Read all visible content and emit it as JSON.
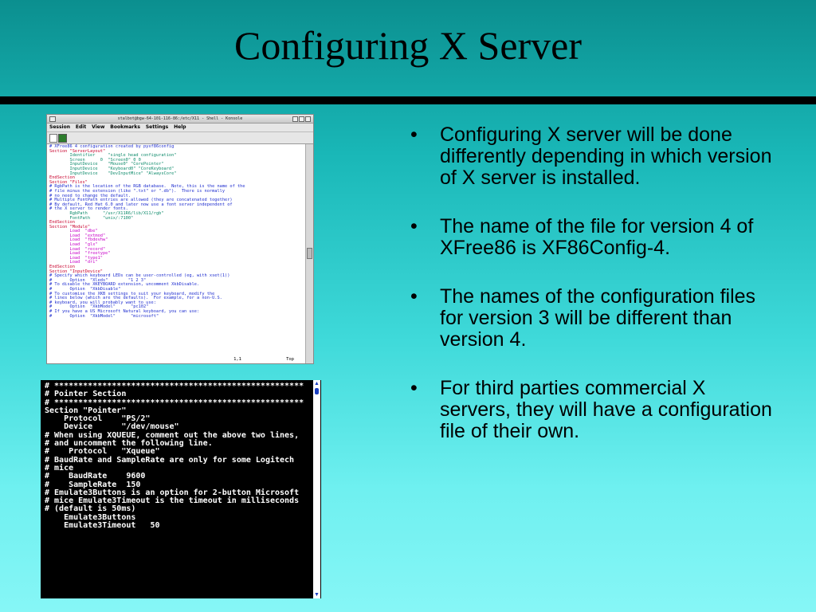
{
  "slide": {
    "title": "Configuring X Server",
    "bullets": [
      "Configuring X server will be done differently depending in which version of X server is installed.",
      "The name of the file for version 4 of XFree86 is XF86Config-4.",
      "The names of the configuration files for version 3 will be different than version 4.",
      "For third parties commercial X servers, they will have a configuration file of their own."
    ],
    "bullet_glyph": "•"
  },
  "konsole": {
    "title": "stalbot@bgw-64-101-116-86:/etc/X11 - Shell - Konsole",
    "menu": [
      "Session",
      "Edit",
      "View",
      "Bookmarks",
      "Settings",
      "Help"
    ],
    "lines": [
      {
        "t": "# XFree86 4 configuration created by pyxf86config",
        "c": "c-blue"
      },
      {
        "t": "",
        "c": ""
      },
      {
        "t": "Section \"ServerLayout\"",
        "c": "c-red"
      },
      {
        "t": "        Identifier     \"single head configuration\"",
        "c": "c-grn"
      },
      {
        "t": "        Screen      0  \"Screen0\" 0 0",
        "c": "c-grn"
      },
      {
        "t": "        InputDevice    \"Mouse0\" \"CorePointer\"",
        "c": "c-grn"
      },
      {
        "t": "        InputDevice    \"Keyboard0\" \"CoreKeyboard\"",
        "c": "c-grn"
      },
      {
        "t": "        InputDevice    \"DevInputMice\" \"AlwaysCore\"",
        "c": "c-grn"
      },
      {
        "t": "EndSection",
        "c": "c-red"
      },
      {
        "t": "",
        "c": ""
      },
      {
        "t": "Section \"Files\"",
        "c": "c-red"
      },
      {
        "t": "",
        "c": ""
      },
      {
        "t": "# RgbPath is the location of the RGB database.  Note, this is the name of the",
        "c": "c-blue"
      },
      {
        "t": "# file minus the extension (like \".txt\" or \".db\").  There is normally",
        "c": "c-blue"
      },
      {
        "t": "# no need to change the default.",
        "c": "c-blue"
      },
      {
        "t": "# Multiple FontPath entries are allowed (they are concatenated together)",
        "c": "c-blue"
      },
      {
        "t": "# By default, Red Hat 6.0 and later now use a font server independent of",
        "c": "c-blue"
      },
      {
        "t": "# the X server to render fonts.",
        "c": "c-blue"
      },
      {
        "t": "        RgbPath      \"/usr/X11R6/lib/X11/rgb\"",
        "c": "c-grn"
      },
      {
        "t": "        FontPath     \"unix/:7100\"",
        "c": "c-grn"
      },
      {
        "t": "EndSection",
        "c": "c-red"
      },
      {
        "t": "",
        "c": ""
      },
      {
        "t": "Section \"Module\"",
        "c": "c-red"
      },
      {
        "t": "        Load  \"dbe\"",
        "c": "c-mag"
      },
      {
        "t": "        Load  \"extmod\"",
        "c": "c-mag"
      },
      {
        "t": "        Load  \"fbdevhw\"",
        "c": "c-mag"
      },
      {
        "t": "        Load  \"glx\"",
        "c": "c-mag"
      },
      {
        "t": "        Load  \"record\"",
        "c": "c-mag"
      },
      {
        "t": "        Load  \"freetype\"",
        "c": "c-mag"
      },
      {
        "t": "        Load  \"type1\"",
        "c": "c-mag"
      },
      {
        "t": "        Load  \"dri\"",
        "c": "c-mag"
      },
      {
        "t": "EndSection",
        "c": "c-red"
      },
      {
        "t": "",
        "c": ""
      },
      {
        "t": "Section \"InputDevice\"",
        "c": "c-red"
      },
      {
        "t": "",
        "c": ""
      },
      {
        "t": "# Specify which keyboard LEDs can be user-controlled (eg, with xset(1))",
        "c": "c-blue"
      },
      {
        "t": "#       Option  \"Xleds\"        \"1 2 3\"",
        "c": "c-blue"
      },
      {
        "t": "# To disable the XKEYBOARD extension, uncomment XkbDisable.",
        "c": "c-blue"
      },
      {
        "t": "#       Option  \"XkbDisable\"",
        "c": "c-blue"
      },
      {
        "t": "# To customise the XKB settings to suit your keyboard, modify the",
        "c": "c-blue"
      },
      {
        "t": "# lines below (which are the defaults).  For example, for a non-U.S.",
        "c": "c-blue"
      },
      {
        "t": "# keyboard, you will probably want to use:",
        "c": "c-blue"
      },
      {
        "t": "#       Option  \"XkbModel\"      \"pc102\"",
        "c": "c-blue"
      },
      {
        "t": "# If you have a US Microsoft Natural keyboard, you can use:",
        "c": "c-blue"
      },
      {
        "t": "#       Option  \"XkbModel\"      \"microsoft\"",
        "c": "c-blue"
      }
    ],
    "cursor_pos": "1,1",
    "scroll_pos": "Top"
  },
  "terminal": {
    "lines": [
      "# ****************************************************",
      "# Pointer Section",
      "# ****************************************************",
      "",
      "Section \"Pointer\"",
      "    Protocol    \"PS/2\"",
      "    Device      \"/dev/mouse\"",
      "",
      "# When using XQUEUE, comment out the above two lines,",
      "# and uncomment the following line.",
      "",
      "#    Protocol   \"Xqueue\"",
      "",
      "# BaudRate and SampleRate are only for some Logitech",
      "# mice",
      "",
      "#    BaudRate    9600",
      "#    SampleRate  150",
      "",
      "# Emulate3Buttons is an option for 2-button Microsoft",
      "# mice Emulate3Timeout is the timeout in milliseconds",
      "# (default is 50ms)",
      "",
      "    Emulate3Buttons",
      "    Emulate3Timeout   50"
    ],
    "scroll_up_icon": "▲",
    "scroll_down_icon": "▼"
  }
}
